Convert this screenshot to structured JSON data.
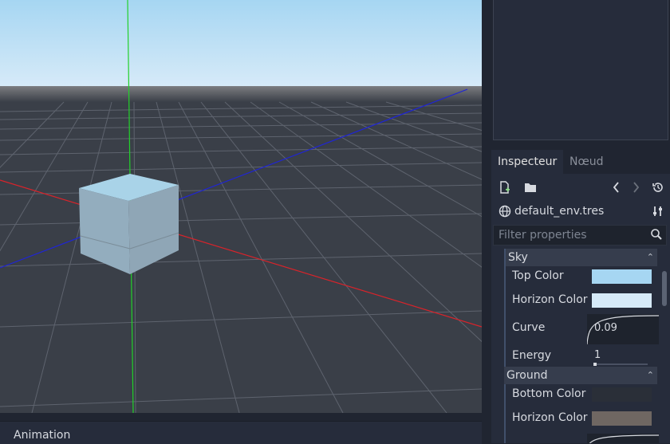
{
  "inspector": {
    "tabs": [
      {
        "label": "Inspecteur"
      },
      {
        "label": "Nœud"
      }
    ],
    "resource_name": "default_env.tres",
    "filter_placeholder": "Filter properties",
    "sections": [
      {
        "title": "Sky",
        "properties": [
          {
            "label": "Top Color",
            "color": "#a6d6f2"
          },
          {
            "label": "Horizon Color",
            "color": "#d6eaf8"
          },
          {
            "label": "Curve",
            "value": "0.09"
          },
          {
            "label": "Energy",
            "value": "1"
          }
        ]
      },
      {
        "title": "Ground",
        "properties": [
          {
            "label": "Bottom Color",
            "color": "#2a2f38"
          },
          {
            "label": "Horizon Color",
            "color": "#6f6762"
          }
        ]
      }
    ]
  },
  "bottom_panel": {
    "label": "Animation"
  },
  "icons": {
    "new": "new-resource-icon",
    "open": "open-folder-icon",
    "prev": "chevron-left-icon",
    "next": "chevron-right-icon",
    "history": "history-icon",
    "globe": "globe-icon",
    "tools": "tools-icon",
    "search": "search-icon",
    "menu": "menu-dots-icon"
  },
  "colors": {
    "sky_top": "#a6d6f2",
    "sky_horizon": "#d6eaf8",
    "ground": "#3a3f48",
    "axis_x": "#d9232a",
    "axis_y": "#22d12a",
    "axis_z": "#1f25d6"
  }
}
